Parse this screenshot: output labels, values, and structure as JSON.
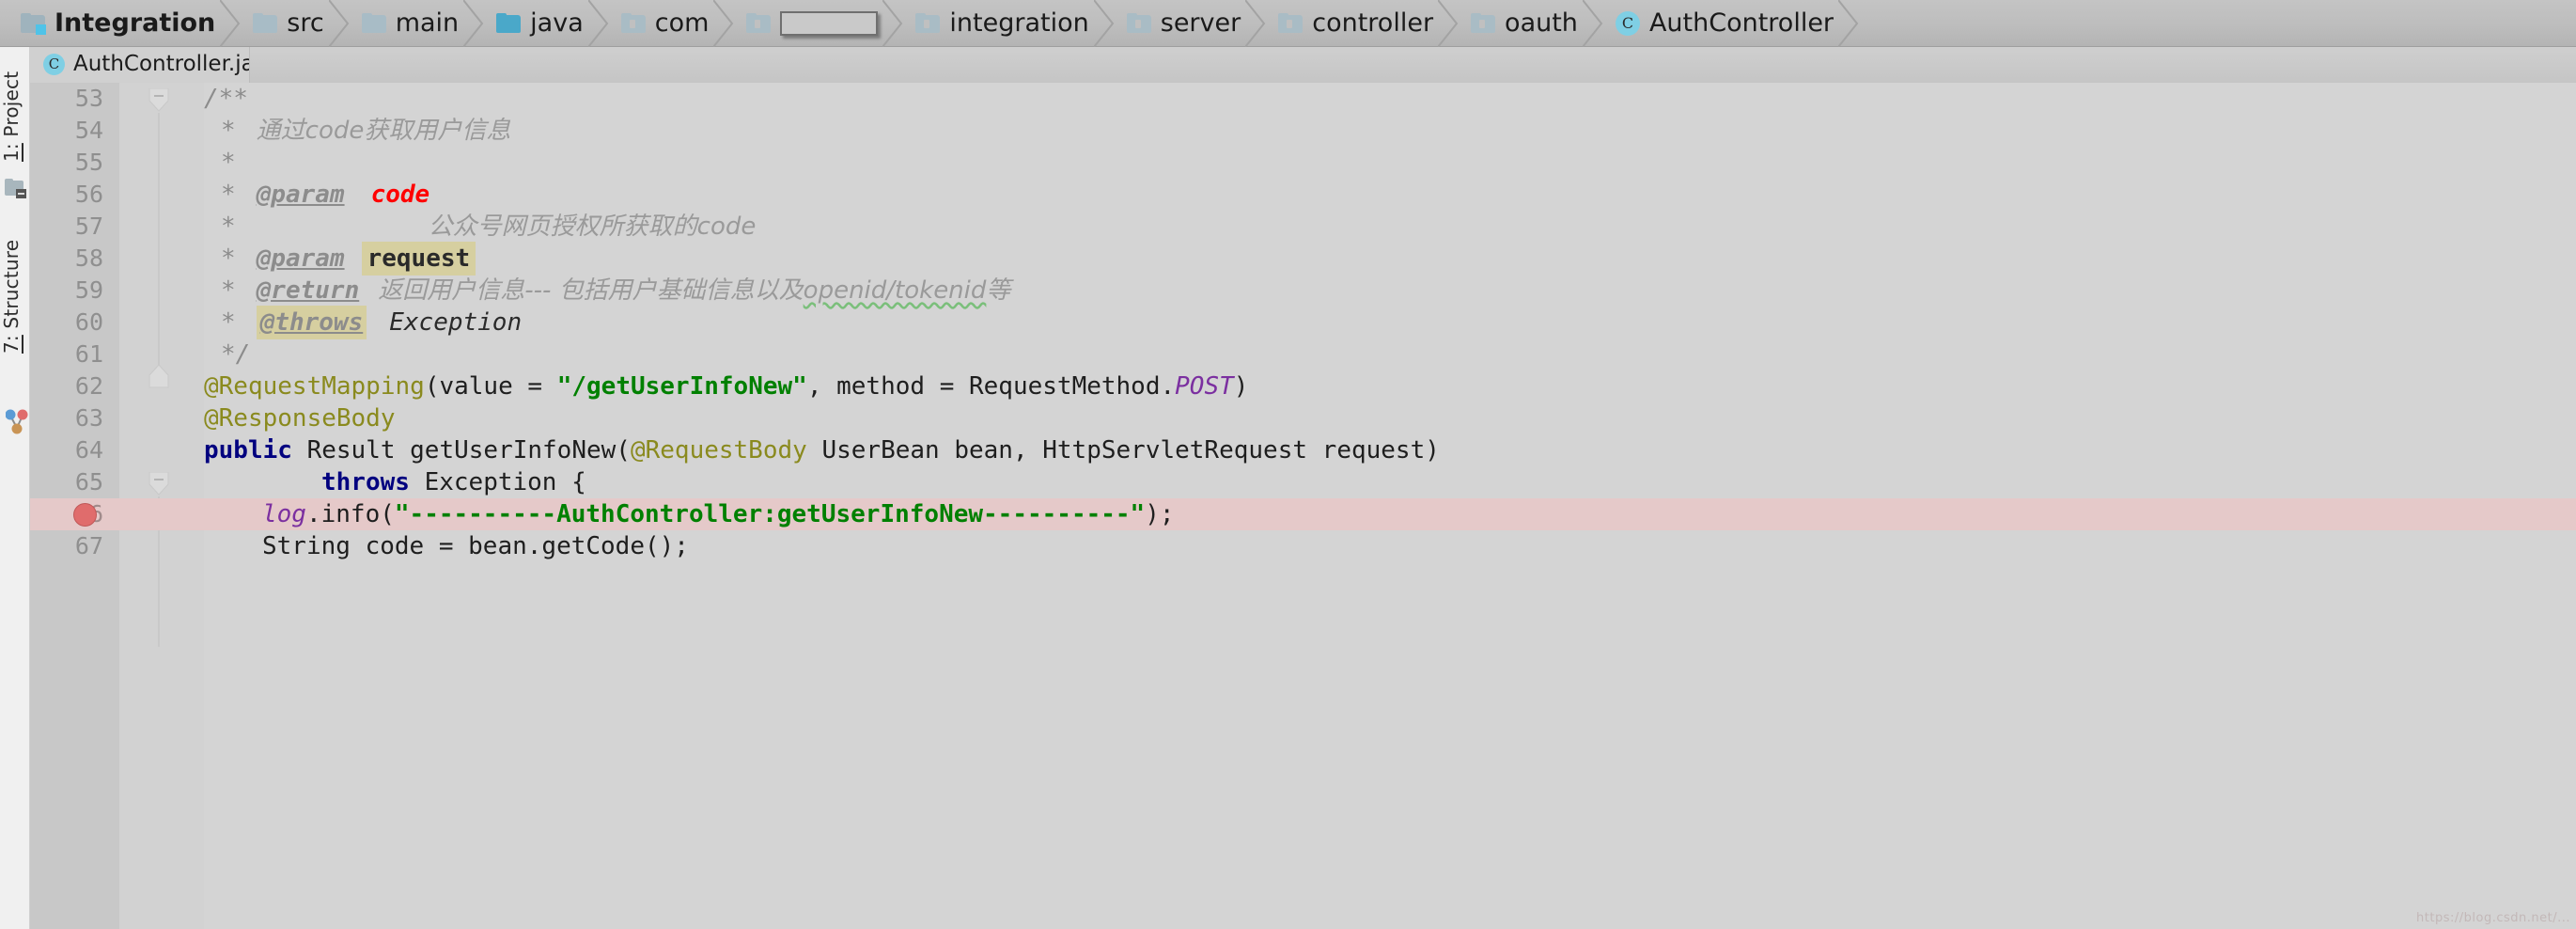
{
  "breadcrumb": {
    "items": [
      {
        "label": "Integration",
        "icon": "folder-module-icon",
        "kind": "module"
      },
      {
        "label": "src",
        "icon": "folder-icon",
        "kind": "folder"
      },
      {
        "label": "main",
        "icon": "folder-icon",
        "kind": "folder"
      },
      {
        "label": "java",
        "icon": "folder-source-icon",
        "kind": "source"
      },
      {
        "label": "com",
        "icon": "folder-package-icon",
        "kind": "package"
      },
      {
        "label": "",
        "icon": "redacted-box",
        "kind": "redacted"
      },
      {
        "label": "integration",
        "icon": "folder-package-icon",
        "kind": "package"
      },
      {
        "label": "server",
        "icon": "folder-package-icon",
        "kind": "package"
      },
      {
        "label": "controller",
        "icon": "folder-package-icon",
        "kind": "package"
      },
      {
        "label": "oauth",
        "icon": "folder-package-icon",
        "kind": "package"
      },
      {
        "label": "AuthController",
        "icon": "class-icon",
        "kind": "class"
      }
    ]
  },
  "toolwindows": {
    "project": {
      "number": "1:",
      "label": " Project"
    },
    "structure": {
      "number": "7:",
      "label": " Structure"
    }
  },
  "tabs": {
    "active": {
      "label": "AuthController.java",
      "icon": "class-icon",
      "close": "×"
    }
  },
  "editor": {
    "first_line": 53,
    "breakpoint_line": 66,
    "highlight_line": 66,
    "lines": [
      {
        "n": 53,
        "text": "    /**"
      },
      {
        "n": 54,
        "text": "     * 通过code获取用户信息"
      },
      {
        "n": 55,
        "text": "     *"
      },
      {
        "n": 56,
        "text": "     * @param  code"
      },
      {
        "n": 57,
        "text": "     *            公众号网页授权所获取的code"
      },
      {
        "n": 58,
        "text": "     * @param request"
      },
      {
        "n": 59,
        "text": "     * @return 返回用户信息--- 包括用户基础信息以及openid/tokenid等"
      },
      {
        "n": 60,
        "text": "     * @throws  Exception"
      },
      {
        "n": 61,
        "text": "     */"
      },
      {
        "n": 62,
        "text": "    @RequestMapping(value = \"/getUserInfoNew\", method = RequestMethod.POST)"
      },
      {
        "n": 63,
        "text": "    @ResponseBody"
      },
      {
        "n": 64,
        "text": "    public Result getUserInfoNew(@RequestBody UserBean bean, HttpServletRequest request)"
      },
      {
        "n": 65,
        "text": "            throws Exception {"
      },
      {
        "n": 66,
        "text": "        log.info(\"----------AuthController:getUserInfoNew----------\");"
      },
      {
        "n": 67,
        "text": "        String code = bean.getCode();"
      }
    ],
    "tokens": {
      "l53_comment": "/**",
      "l54_star": "*",
      "l54_text": "通过code获取用户信息",
      "l55_star": "*",
      "l56_star": "*",
      "l56_tag": "@param",
      "l56_value": "code",
      "l57_star": "*",
      "l57_text": "公众号网页授权所获取的code",
      "l58_star": "*",
      "l58_tag": "@param",
      "l58_value": "request",
      "l59_star": "*",
      "l59_tag": "@return",
      "l59_text_a": "返回用户信息--- 包括用户基础信息以及",
      "l59_text_b": "openid/tokenid",
      "l59_text_c": "等",
      "l60_star": "*",
      "l60_tag": "@throws",
      "l60_value": "Exception",
      "l61_comment": "*/",
      "l62_anno": "@RequestMapping",
      "l62_p1": "(value = ",
      "l62_str": "\"/getUserInfoNew\"",
      "l62_p2": ", method = RequestMethod.",
      "l62_static": "POST",
      "l62_p3": ")",
      "l63_anno": "@ResponseBody",
      "l64_kw": "public",
      "l64_p1": " Result getUserInfoNew(",
      "l64_anno": "@RequestBody",
      "l64_p2": " UserBean bean, HttpServletRequest request)",
      "l65_kw": "throws",
      "l65_p1": " Exception {",
      "l66_field": "log",
      "l66_p1": ".info(",
      "l66_str": "\"----------AuthController:getUserInfoNew----------\"",
      "l66_p2": ");",
      "l67_p1": "String code = bean.getCode();"
    }
  },
  "watermark": "https://blog.csdn.net/...",
  "colors": {
    "navbar_bg": "#bdbdbd",
    "editor_bg": "#d4d4d4",
    "gutter_bg": "#c8c8c8",
    "breakpoint": "#e06c6c",
    "highlight_line_bg": "#e5c9c9",
    "javadoc_gray": "#8c8c8c",
    "javadoc_value_red": "#ff0000",
    "javadoc_value_highlight": "#d6cfa0",
    "annotation": "#8a8a1e",
    "keyword": "#00007f",
    "string": "#008000",
    "static_field": "#7b2fa0",
    "class_icon": "#7fcfe4"
  }
}
